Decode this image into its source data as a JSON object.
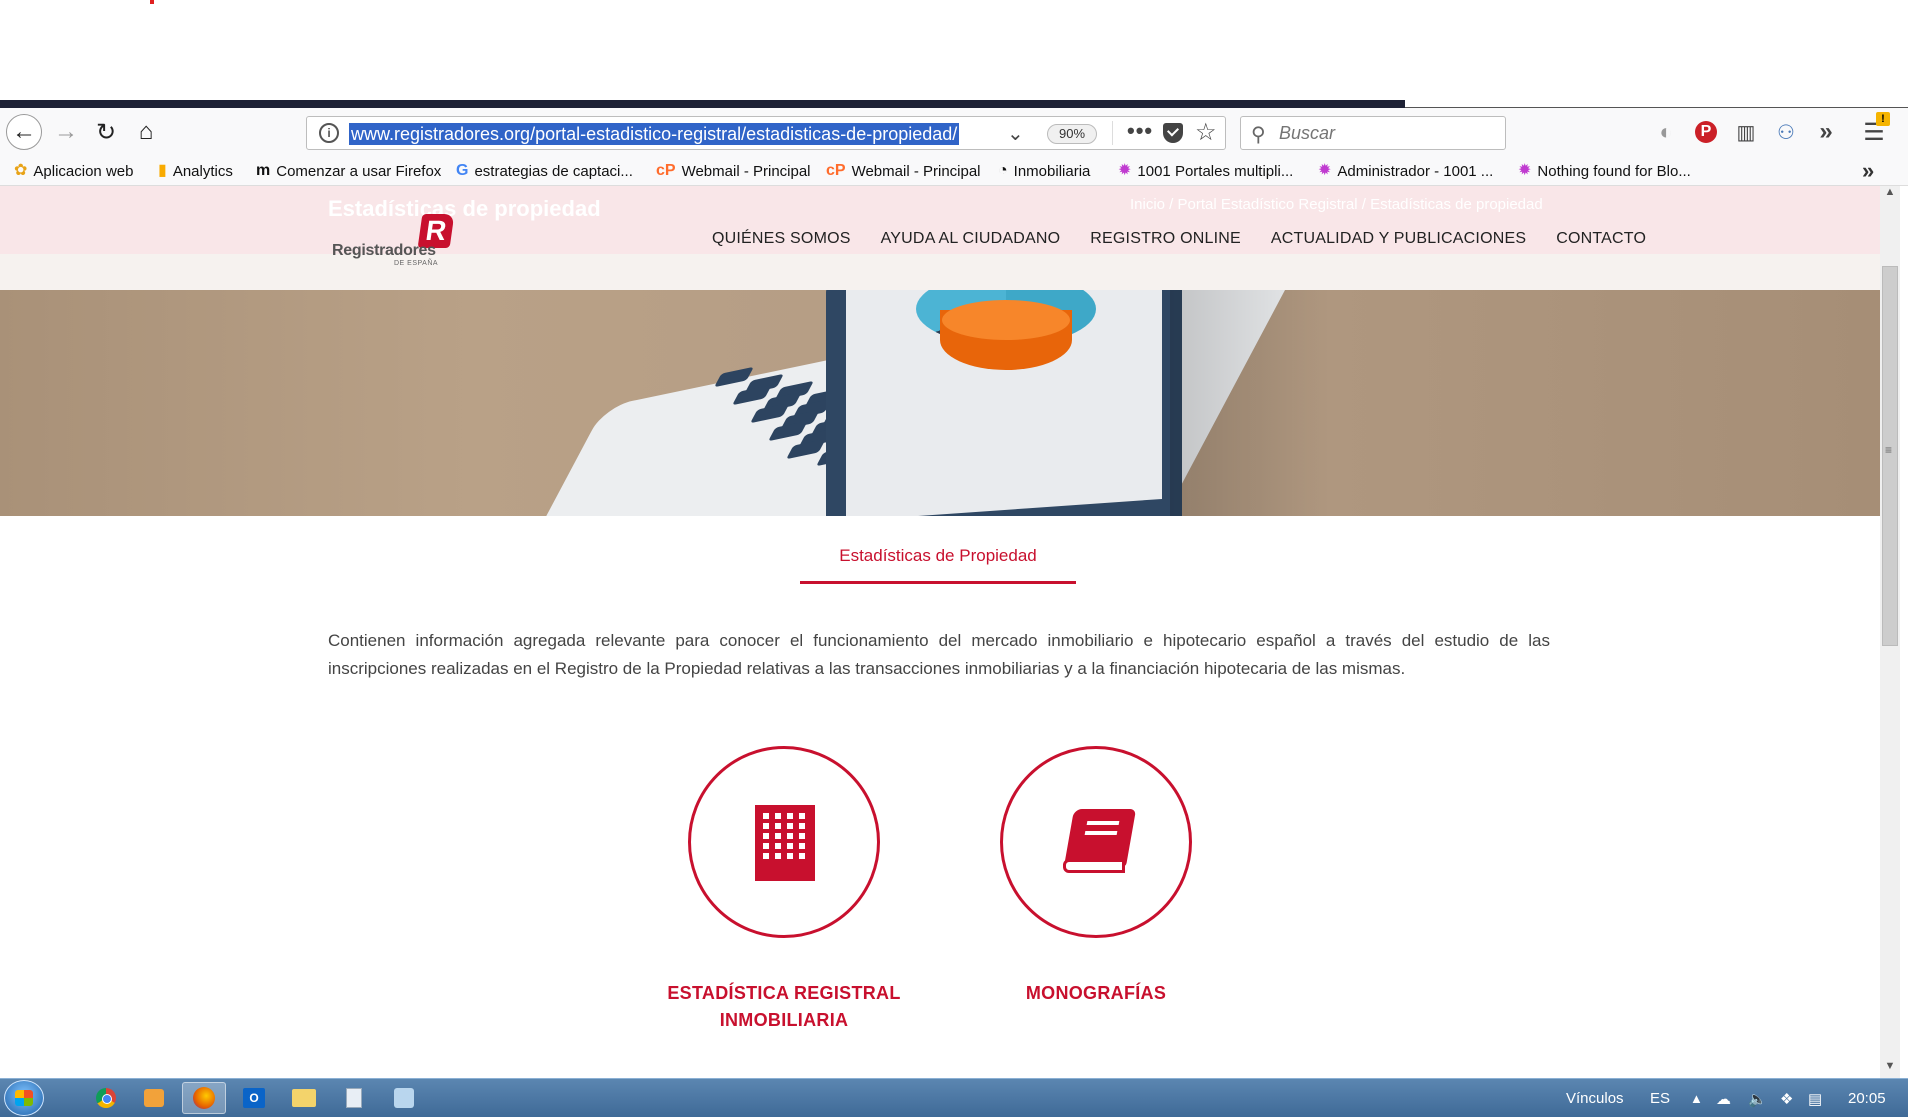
{
  "browser": {
    "url": "www.registradores.org/portal-estadistico-registral/estadisticas-de-propiedad/",
    "zoom": "90%",
    "search_placeholder": "Buscar",
    "menu_badge": "!"
  },
  "bookmarks": [
    {
      "label": "Aplicacion web",
      "icon": "app-icon"
    },
    {
      "label": "Analytics",
      "icon": "analytics-icon"
    },
    {
      "label": "Comenzar a usar Firefox",
      "icon": "m-icon"
    },
    {
      "label": "estrategias de captaci...",
      "icon": "google-icon"
    },
    {
      "label": "Webmail - Principal",
      "icon": "cpanel-icon"
    },
    {
      "label": "Webmail - Principal",
      "icon": "cpanel-icon"
    },
    {
      "label": "Inmobiliaria",
      "icon": "rss-icon"
    },
    {
      "label": "1001 Portales multipli...",
      "icon": "starburst-icon"
    },
    {
      "label": "Administrador - 1001 ...",
      "icon": "starburst-icon"
    },
    {
      "label": "Nothing found for Blo...",
      "icon": "starburst-icon"
    }
  ],
  "site": {
    "ghost_title": "Estadísticas de propiedad",
    "ghost_breadcrumb": "Inicio / Portal Estadístico Registral / Estadísticas de propiedad",
    "logo_letter": "R",
    "logo_word": "Registradores",
    "logo_sub": "DE ESPAÑA",
    "nav": [
      "QUIÉNES SOMOS",
      "AYUDA AL CIUDADANO",
      "REGISTRO ONLINE",
      "ACTUALIDAD Y PUBLICACIONES",
      "CONTACTO"
    ],
    "section_tab": "Estadísticas de Propiedad",
    "intro": "Contienen información agregada relevante para conocer el funcionamiento del mercado inmobiliario e hipotecario español a través del estudio de las inscripciones realizadas en el Registro de la Propiedad relativas a las transacciones inmobiliarias y a la financiación hipotecaria de las mismas.",
    "cards": [
      {
        "line1": "ESTADÍSTICA REGISTRAL",
        "line2": "INMOBILIARIA",
        "icon": "building-icon"
      },
      {
        "line1": "MONOGRAFÍAS",
        "line2": "",
        "icon": "book-icon"
      }
    ]
  },
  "taskbar": {
    "links_label": "Vínculos",
    "lang": "ES",
    "time": "20:05"
  },
  "colors": {
    "brand_red": "#c8102e",
    "selection_blue": "#3064c8"
  }
}
